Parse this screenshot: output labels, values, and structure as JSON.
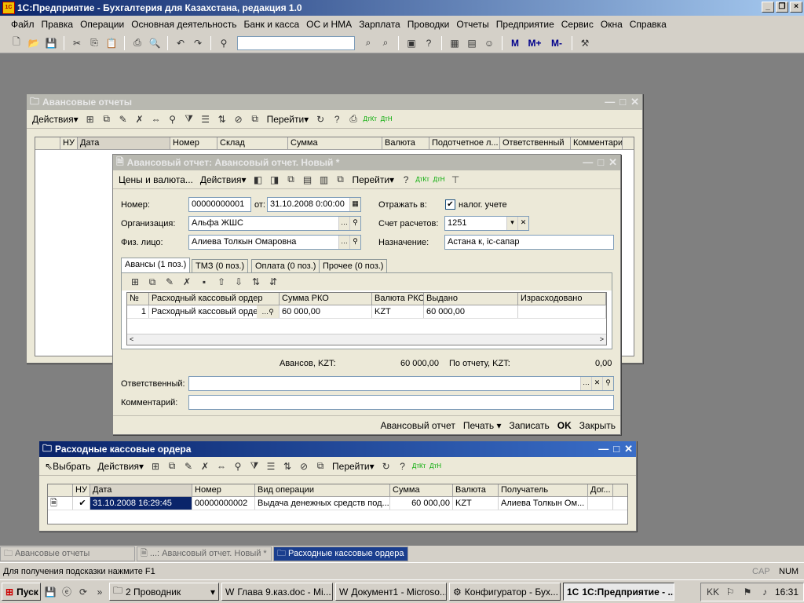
{
  "app": {
    "title": "1С:Предприятие - Бухгалтерия для Казахстана, редакция 1.0"
  },
  "menu": [
    "Файл",
    "Правка",
    "Операции",
    "Основная деятельность",
    "Банк и касса",
    "ОС и НМА",
    "Зарплата",
    "Проводки",
    "Отчеты",
    "Предприятие",
    "Сервис",
    "Окна",
    "Справка"
  ],
  "win_adv_list": {
    "title": "Авансовые отчеты",
    "actions": "Действия",
    "goto": "Перейти",
    "columns": [
      "НУ",
      "Дата",
      "Номер",
      "Склад",
      "Сумма",
      "Валюта",
      "Подотчетное л...",
      "Ответственный",
      "Комментарий"
    ]
  },
  "win_adv": {
    "title": "Авансовый отчет: Авансовый отчет. Новый *",
    "prices": "Цены и валюта...",
    "actions": "Действия",
    "goto": "Перейти",
    "number_label": "Номер:",
    "number": "00000000001",
    "from_label": "от:",
    "date": "31.10.2008 0:00:00",
    "reflect_label": "Отражать в:",
    "tax_label": "налог. учете",
    "org_label": "Организация:",
    "org": "Альфа ЖШС",
    "account_label": "Счет расчетов:",
    "account": "1251",
    "person_label": "Физ. лицо:",
    "person": "Алиева Толкын Омаровна",
    "purpose_label": "Назначение:",
    "purpose": "Астана к, іс-сапар",
    "tabs": [
      "Авансы (1 поз.)",
      "ТМЗ (0 поз.)",
      "Оплата (0 поз.)",
      "Прочее (0 поз.)"
    ],
    "grid_columns": [
      "№",
      "Расходный кассовый ордер",
      "Сумма РКО",
      "Валюта РКО",
      "Выдано",
      "Израсходовано"
    ],
    "grid_row": [
      "1",
      "Расходный кассовый орде",
      "60 000,00",
      "KZT",
      "60 000,00",
      ""
    ],
    "advances_label": "Авансов, KZT:",
    "advances": "60 000,00",
    "report_label": "По отчету, KZT:",
    "report": "0,00",
    "resp_label": "Ответственный:",
    "comment_label": "Комментарий:",
    "footer": [
      "Авансовый отчет",
      "Печать",
      "Записать",
      "OK",
      "Закрыть"
    ]
  },
  "win_rko": {
    "title": "Расходные кассовые ордера",
    "choose": "Выбрать",
    "actions": "Действия",
    "goto": "Перейти",
    "columns": [
      "НУ",
      "Дата",
      "Номер",
      "Вид операции",
      "Сумма",
      "Валюта",
      "Получатель",
      "Дог..."
    ],
    "row": [
      "",
      "31.10.2008 16:29:45",
      "00000000002",
      "Выдача денежных средств под...",
      "60 000,00",
      "KZT",
      "Алиева Толкын Ом..."
    ]
  },
  "windows_bar": [
    "Авансовые отчеты",
    "...: Авансовый отчет. Новый *",
    "Расходные кассовые ордера"
  ],
  "status": {
    "hint": "Для получения подсказки нажмите F1",
    "cap": "CAP",
    "num": "NUM"
  },
  "taskbar": {
    "start": "Пуск",
    "items": [
      "2 Проводник",
      "Глава 9.каз.doc - Mi...",
      "Документ1 - Microso...",
      "Конфигуратор - Бух...",
      "1С:Предприятие - ..."
    ],
    "time": "16:31"
  }
}
